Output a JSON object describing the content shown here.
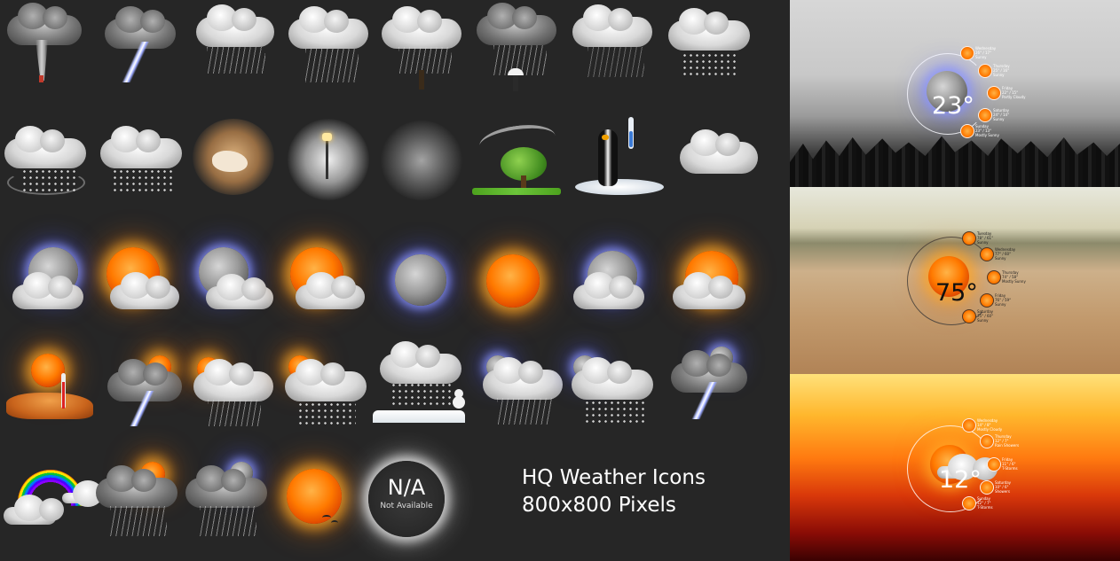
{
  "caption": {
    "line1": "HQ Weather Icons",
    "line2": "800x800 Pixels"
  },
  "na_icon": {
    "title": "N/A",
    "subtitle": "Not Available"
  },
  "icons": [
    "tornado-icon",
    "thunderstorm-icon",
    "rain-icon",
    "heavy-rain-icon",
    "rain-umbrella-person-icon",
    "rain-umbrella-icon",
    "drizzle-icon",
    "snow-cloud-icon",
    "hail-wind-icon",
    "snow-flurries-icon",
    "dust-storm-icon",
    "fog-streetlamp-icon",
    "smoke-icon",
    "windy-tree-icon",
    "cold-penguin-icon",
    "cloudy-icon",
    "night-partly-cloudy-icon",
    "day-partly-cloudy-icon",
    "night-mostly-cloudy-icon",
    "day-mostly-cloudy-icon",
    "clear-night-icon",
    "sunny-icon",
    "night-cloudy-icon",
    "day-cloudy-icon",
    "hot-desert-icon",
    "day-thunderstorm-icon",
    "day-rain-icon",
    "day-snow-icon",
    "snowman-icon",
    "night-rain-icon",
    "night-snow-icon",
    "night-thunderstorm-icon",
    "rainbow-icon",
    "day-heavy-rain-icon",
    "night-heavy-rain-icon",
    "sun-birds-icon",
    "not-available-icon"
  ],
  "previews": [
    {
      "name": "fog",
      "temp": "23°",
      "forecast": [
        {
          "day": "Wednesday",
          "temp": "26° / 17°",
          "cond": "Sunny"
        },
        {
          "day": "Thursday",
          "temp": "25° / 16°",
          "cond": "Sunny"
        },
        {
          "day": "Friday",
          "temp": "22° / 15°",
          "cond": "Partly Cloudy"
        },
        {
          "day": "Saturday",
          "temp": "24° / 14°",
          "cond": "Sunny"
        },
        {
          "day": "Sunday",
          "temp": "23° / 13°",
          "cond": "Mostly Sunny"
        }
      ]
    },
    {
      "name": "sand",
      "temp": "75°",
      "forecast": [
        {
          "day": "Tuesday",
          "temp": "78° / 61°",
          "cond": "Sunny"
        },
        {
          "day": "Wednesday",
          "temp": "77° / 60°",
          "cond": "Sunny"
        },
        {
          "day": "Thursday",
          "temp": "74° / 58°",
          "cond": "Mostly Sunny"
        },
        {
          "day": "Friday",
          "temp": "76° / 59°",
          "cond": "Sunny"
        },
        {
          "day": "Saturday",
          "temp": "75° / 60°",
          "cond": "Sunny"
        }
      ]
    },
    {
      "name": "sunset",
      "temp": "12°",
      "forecast": [
        {
          "day": "Wednesday",
          "temp": "14° / 8°",
          "cond": "Mostly Cloudy"
        },
        {
          "day": "Thursday",
          "temp": "12° / 7°",
          "cond": "Rain Showers"
        },
        {
          "day": "Friday",
          "temp": "11° / 6°",
          "cond": "T-Storms"
        },
        {
          "day": "Saturday",
          "temp": "10° / 6°",
          "cond": "Showers"
        },
        {
          "day": "Sunday",
          "temp": "12° / 7°",
          "cond": "T-Storms"
        }
      ]
    }
  ]
}
